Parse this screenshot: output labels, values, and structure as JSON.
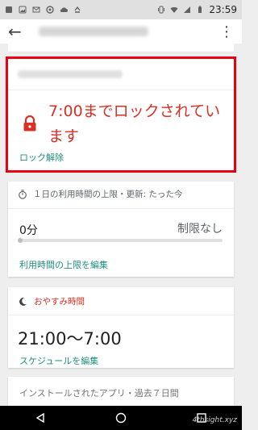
{
  "status_bar": {
    "time": "23:59"
  },
  "lock_card": {
    "message": "7:00までロックされています",
    "unlock_label": "ロック解除"
  },
  "usage_card": {
    "header": "１日の利用時間の上限・更新: たった今",
    "used": "0分",
    "limit": "制限なし",
    "usage_fraction": 0,
    "edit_label": "利用時間の上限を編集"
  },
  "bedtime_card": {
    "header": "おやすみ時間",
    "schedule": "21:00〜7:00",
    "edit_label": "スケジュールを編集"
  },
  "apps_card": {
    "header": "インストールされたアプリ・過去７日間"
  },
  "watermark": "4thsight.xyz",
  "colors": {
    "accent_red": "#d93025",
    "highlight_border": "#e60012",
    "link_teal": "#1e8e7e"
  }
}
